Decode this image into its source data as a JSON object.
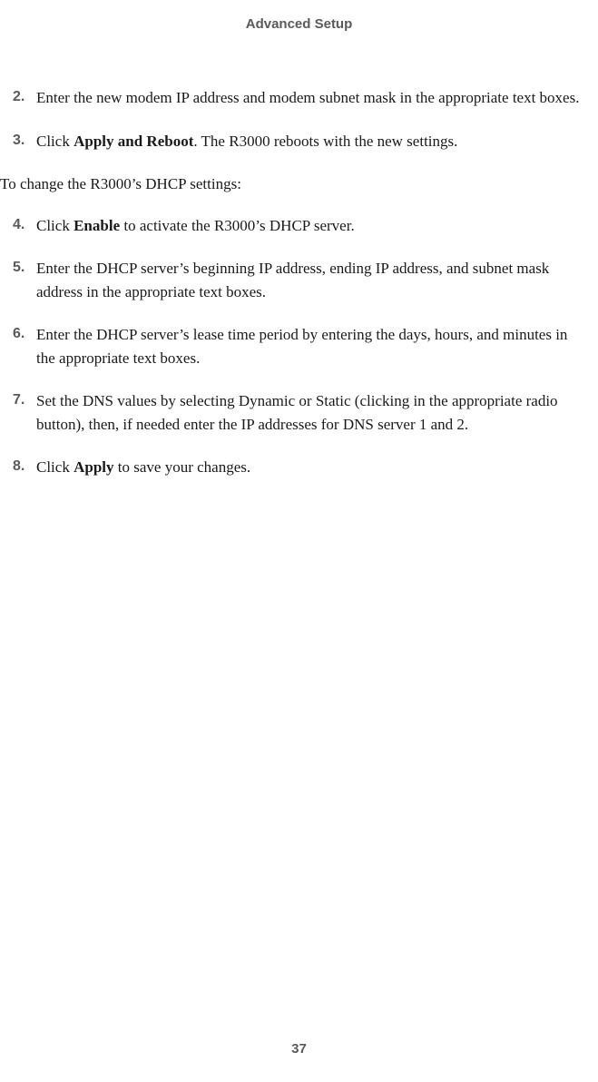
{
  "header": {
    "title": "Advanced Setup"
  },
  "steps": {
    "s2": {
      "num": "2.",
      "text": "Enter the new modem IP address and modem subnet mask in the appropriate text boxes."
    },
    "s3": {
      "num": "3.",
      "prefix": "Click ",
      "bold": "Apply and Reboot",
      "suffix": ". The R3000 reboots with the new settings."
    },
    "intro": "To change the R3000’s DHCP settings:",
    "s4": {
      "num": "4.",
      "prefix": "Click ",
      "bold": "Enable",
      "suffix": " to activate the R3000’s DHCP server."
    },
    "s5": {
      "num": "5.",
      "text": "Enter the DHCP server’s beginning IP address, ending IP address, and subnet mask address in the appropriate text boxes."
    },
    "s6": {
      "num": "6.",
      "text": "Enter the DHCP server’s lease time period by entering the days, hours, and minutes in the appropriate text boxes."
    },
    "s7": {
      "num": "7.",
      "text": "Set the DNS values by selecting Dynamic or Static (clicking in the appropriate radio button), then, if needed enter the IP addresses for DNS server 1 and 2."
    },
    "s8": {
      "num": "8.",
      "prefix": "Click ",
      "bold": "Apply",
      "suffix": " to save your changes."
    }
  },
  "footer": {
    "page_number": "37"
  }
}
